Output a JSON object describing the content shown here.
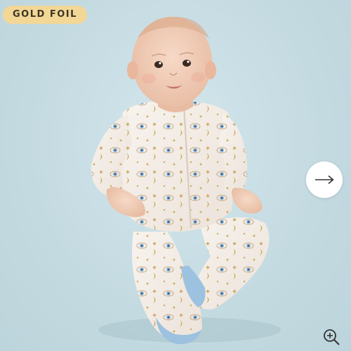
{
  "badge": {
    "label": "GOLD FOIL",
    "color": "#f2d796"
  },
  "photo": {
    "description_icon": "product-photo"
  },
  "controls": {
    "next_icon": "arrow-right-icon",
    "zoom_icon": "zoom-in-icon"
  },
  "colors": {
    "background": "#c9dde3",
    "garment": "#f5efe8",
    "eye_print": "#6e9fc8",
    "gold_print": "#c9a24e"
  }
}
